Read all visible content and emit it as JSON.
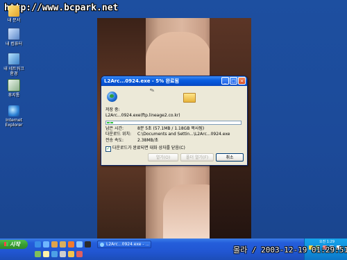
{
  "watermark": "http://www.bcpark.net",
  "desktop_icons": [
    {
      "label": "내 문서",
      "icon": "my-documents-icon"
    },
    {
      "label": "내 컴퓨터",
      "icon": "my-computer-icon"
    },
    {
      "label": "내 네트워크 환경",
      "icon": "network-places-icon"
    },
    {
      "label": "휴지통",
      "icon": "recycle-bin-icon"
    },
    {
      "label": "Internet Explorer",
      "icon": "internet-explorer-icon"
    }
  ],
  "dialog": {
    "title": "L2Arc...0924.exe - 5% 완료됨",
    "saving_label": "저장 중:",
    "saving_value": "L2Arc...0924.exe(ftp.lineage2.co.kr)",
    "progress_percent": 5,
    "rows": [
      {
        "key": "남은 시간:",
        "value": "8분 5초 (57.1MB / 1.18GB 복사됨)"
      },
      {
        "key": "다운로드 위치:",
        "value": "C:\\Documents and Settin...\\L2Arc...0924.exe"
      },
      {
        "key": "전송 속도:",
        "value": "2.38MB/초"
      }
    ],
    "close_checkbox_label": "다운로드가 완료되면 대화 상자를 닫음(C)",
    "close_checkbox_checked": true,
    "buttons": {
      "open": "열기(O)",
      "open_folder": "폴더 열기(F)",
      "cancel": "취소"
    }
  },
  "taskbar": {
    "start_label": "시작",
    "task_label": "L2Arc...0924.exe - ...",
    "tray_text": "오전 1:29"
  },
  "overlay_clock": "몰라 / 2003-12-19 01:29:51",
  "colors": {
    "desktop": "#1c4a99",
    "title_bar": "#0553d4",
    "start_button": "#3a9f33",
    "progress": "#2fbf3a"
  }
}
